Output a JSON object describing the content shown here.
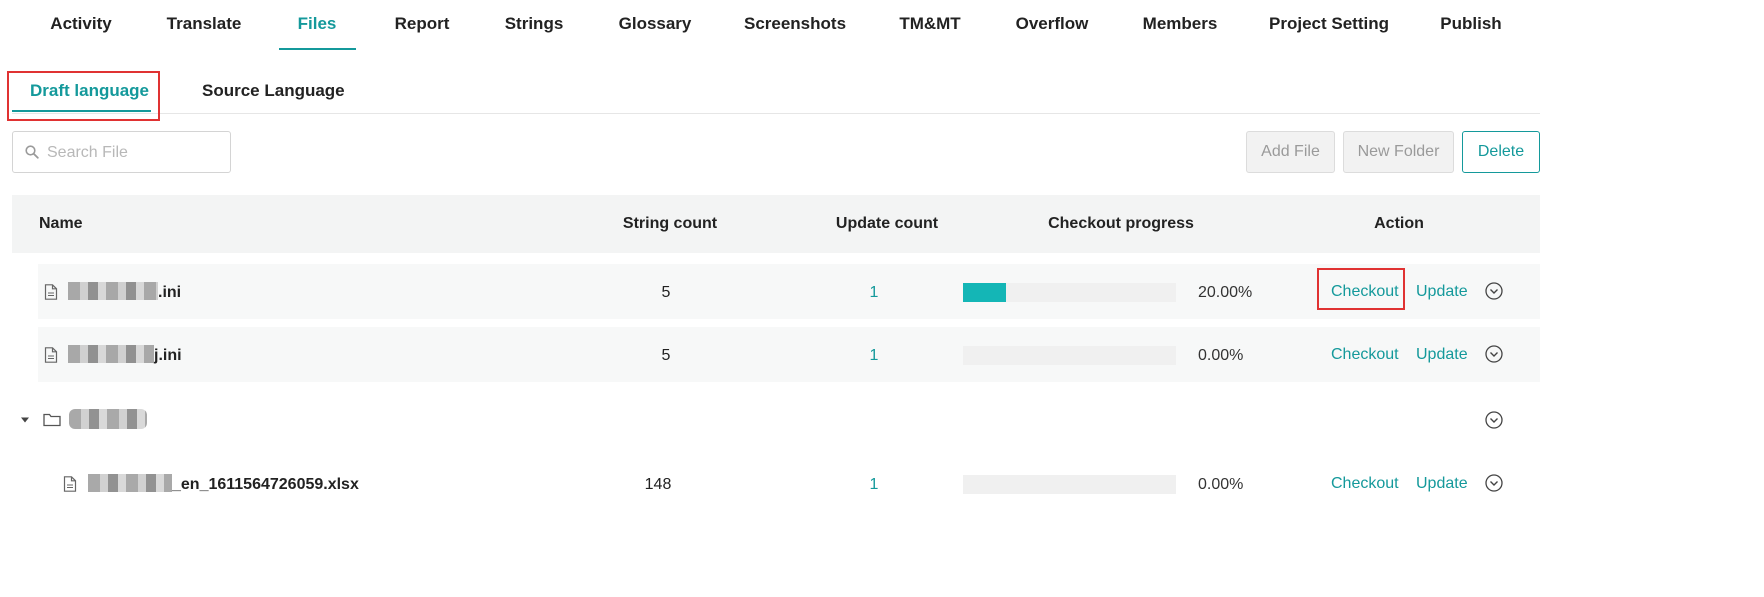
{
  "nav": {
    "tabs": [
      {
        "label": "Activity"
      },
      {
        "label": "Translate"
      },
      {
        "label": "Files",
        "active": true
      },
      {
        "label": "Report"
      },
      {
        "label": "Strings"
      },
      {
        "label": "Glossary"
      },
      {
        "label": "Screenshots"
      },
      {
        "label": "TM&MT"
      },
      {
        "label": "Overflow"
      },
      {
        "label": "Members"
      },
      {
        "label": "Project Setting"
      },
      {
        "label": "Publish"
      }
    ]
  },
  "subtabs": {
    "draft": "Draft language",
    "source": "Source Language"
  },
  "toolbar": {
    "search_placeholder": "Search File",
    "add_file": "Add File",
    "new_folder": "New Folder",
    "delete": "Delete"
  },
  "table": {
    "headers": {
      "name": "Name",
      "string_count": "String count",
      "update_count": "Update count",
      "checkout_progress": "Checkout progress",
      "action": "Action"
    },
    "rows": [
      {
        "type": "file",
        "name_suffix": ".ini",
        "string_count": "5",
        "update_count": "1",
        "progress": 0.2,
        "progress_text": "20.00%",
        "checkout": "Checkout",
        "update": "Update"
      },
      {
        "type": "file",
        "name_suffix": "j.ini",
        "string_count": "5",
        "update_count": "1",
        "progress": 0.0,
        "progress_text": "0.00%",
        "checkout": "Checkout",
        "update": "Update"
      },
      {
        "type": "folder"
      },
      {
        "type": "file",
        "name_suffix": "_en_1611564726059.xlsx",
        "string_count": "148",
        "update_count": "1",
        "progress": 0.0,
        "progress_text": "0.00%",
        "checkout": "Checkout",
        "update": "Update"
      }
    ]
  },
  "colors": {
    "accent": "#14999b",
    "progress_fill": "#14b6b6",
    "highlight": "#e03232"
  }
}
